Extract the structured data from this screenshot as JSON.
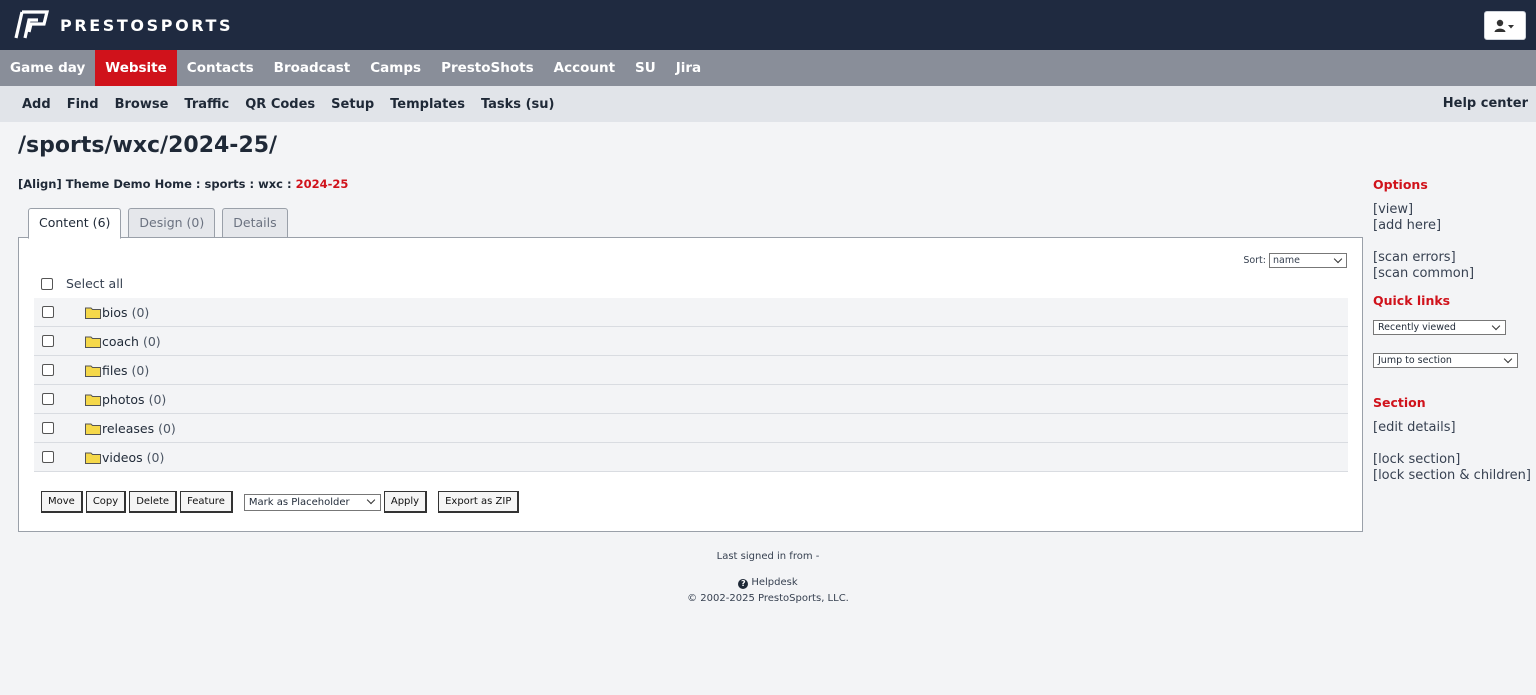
{
  "header": {
    "brand": "PRESTOSPORTS"
  },
  "main_nav": [
    {
      "label": "Game day"
    },
    {
      "label": "Website",
      "active": true
    },
    {
      "label": "Contacts"
    },
    {
      "label": "Broadcast"
    },
    {
      "label": "Camps"
    },
    {
      "label": "PrestoShots"
    },
    {
      "label": "Account"
    },
    {
      "label": "SU"
    },
    {
      "label": "Jira"
    }
  ],
  "sub_nav": [
    "Add",
    "Find",
    "Browse",
    "Traffic",
    "QR Codes",
    "Setup",
    "Templates",
    "Tasks (su)"
  ],
  "help_center": "Help center",
  "page": {
    "title": "/sports/wxc/2024-25/",
    "breadcrumb": [
      {
        "label": "[Align] Theme Demo Home"
      },
      {
        "label": "sports"
      },
      {
        "label": "wxc"
      },
      {
        "label": "2024-25",
        "current": true
      }
    ],
    "breadcrumb_sep": " : "
  },
  "tabs": [
    {
      "label": "Content (6)",
      "active": true
    },
    {
      "label": "Design (0)"
    },
    {
      "label": "Details"
    }
  ],
  "content": {
    "sort_label": "Sort:",
    "sort_value": "name",
    "select_all": "Select all",
    "folders": [
      {
        "name": "bios",
        "count": "(0)"
      },
      {
        "name": "coach",
        "count": "(0)"
      },
      {
        "name": "files",
        "count": "(0)"
      },
      {
        "name": "photos",
        "count": "(0)"
      },
      {
        "name": "releases",
        "count": "(0)"
      },
      {
        "name": "videos",
        "count": "(0)"
      }
    ],
    "actions": {
      "move": "Move",
      "copy": "Copy",
      "delete": "Delete",
      "feature": "Feature",
      "mark_select": "Mark as Placeholder",
      "apply": "Apply",
      "export": "Export as ZIP"
    }
  },
  "sidebar": {
    "options_heading": "Options",
    "view": "[view]",
    "add_here": "[add here]",
    "scan_errors": "[scan errors]",
    "scan_common": "[scan common]",
    "quick_links_heading": "Quick links",
    "recently_viewed": "Recently viewed",
    "jump_to_section": "Jump to section",
    "section_heading": "Section",
    "edit_details": "[edit details]",
    "lock_section": "[lock section]",
    "lock_section_children": "[lock section & children]"
  },
  "footer": {
    "last_signed": "Last signed in from -",
    "helpdesk": "Helpdesk",
    "copyright": "© 2002-2025 PrestoSports, LLC."
  },
  "colors": {
    "topbar": "#1f2a40",
    "mainnav": "#898e99",
    "accent": "#d0121b",
    "subnav": "#e1e4e9",
    "folder": "#f5d84a"
  }
}
